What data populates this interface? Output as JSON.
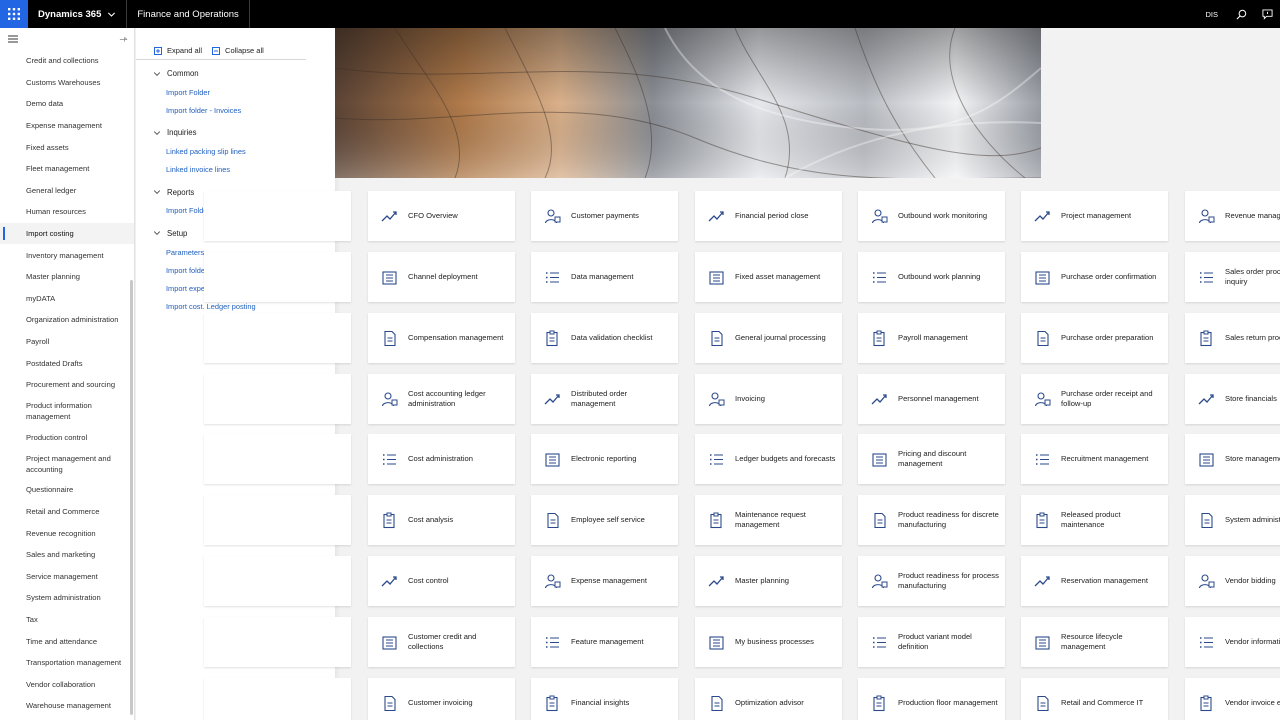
{
  "topbar": {
    "brand": "Dynamics 365",
    "product": "Finance and Operations",
    "company": "DIS",
    "icons": [
      "waffle-icon",
      "chevron-down-icon",
      "search-icon",
      "message-icon"
    ]
  },
  "accent": "#2266e3",
  "leftnav": {
    "items": [
      {
        "label": "Credit and collections"
      },
      {
        "label": "Customs Warehouses"
      },
      {
        "label": "Demo data"
      },
      {
        "label": "Expense management"
      },
      {
        "label": "Fixed assets"
      },
      {
        "label": "Fleet management"
      },
      {
        "label": "General ledger"
      },
      {
        "label": "Human resources"
      },
      {
        "label": "Import costing",
        "active": true
      },
      {
        "label": "Inventory management"
      },
      {
        "label": "Master planning"
      },
      {
        "label": "myDATA"
      },
      {
        "label": "Organization administration"
      },
      {
        "label": "Payroll"
      },
      {
        "label": "Postdated Drafts"
      },
      {
        "label": "Procurement and sourcing"
      },
      {
        "label": "Product information management"
      },
      {
        "label": "Production control"
      },
      {
        "label": "Project management and accounting"
      },
      {
        "label": "Questionnaire"
      },
      {
        "label": "Retail and Commerce"
      },
      {
        "label": "Revenue recognition"
      },
      {
        "label": "Sales and marketing"
      },
      {
        "label": "Service management"
      },
      {
        "label": "System administration"
      },
      {
        "label": "Tax"
      },
      {
        "label": "Time and attendance"
      },
      {
        "label": "Transportation management"
      },
      {
        "label": "Vendor collaboration"
      },
      {
        "label": "Warehouse management"
      }
    ]
  },
  "flyout": {
    "expand_all": "Expand all",
    "collapse_all": "Collapse all",
    "groups": [
      {
        "title": "Common",
        "links": [
          "Import Folder",
          "Import folder - Invoices"
        ]
      },
      {
        "title": "Inquiries",
        "links": [
          "Linked packing slip lines",
          "Linked invoice lines"
        ]
      },
      {
        "title": "Reports",
        "links": [
          "Import Folder"
        ]
      },
      {
        "title": "Setup",
        "links": [
          "Parameters",
          "Import folder type",
          "Import expense types",
          "Import cost. Ledger posting"
        ]
      }
    ]
  },
  "workspaces": {
    "columns": [
      [
        "CFO Overview",
        "Channel deployment",
        "Compensation management",
        "Cost accounting ledger administration",
        "Cost administration",
        "Cost analysis",
        "Cost control",
        "Customer credit and collections",
        "Customer invoicing"
      ],
      [
        "Customer payments",
        "Data management",
        "Data validation checklist",
        "Distributed order management",
        "Electronic reporting",
        "Employee self service",
        "Expense management",
        "Feature management",
        "Financial insights"
      ],
      [
        "Financial period close",
        "Fixed asset management",
        "General journal processing",
        "Invoicing",
        "Ledger budgets and forecasts",
        "Maintenance request management",
        "Master planning",
        "My business processes",
        "Optimization advisor"
      ],
      [
        "Outbound work monitoring",
        "Outbound work planning",
        "Payroll management",
        "Personnel management",
        "Pricing and discount management",
        "Product readiness for discrete manufacturing",
        "Product readiness for process manufacturing",
        "Product variant model definition",
        "Production floor management"
      ],
      [
        "Project management",
        "Purchase order confirmation",
        "Purchase order preparation",
        "Purchase order receipt and follow-up",
        "Recruitment management",
        "Released product maintenance",
        "Reservation management",
        "Resource lifecycle management",
        "Retail and Commerce IT"
      ],
      [
        "Revenue management",
        "Sales order processing and inquiry",
        "Sales return processing",
        "Store financials",
        "Store management",
        "System administration",
        "Vendor bidding",
        "Vendor information",
        "Vendor invoice entry"
      ]
    ],
    "icons": [
      "chart-line-icon",
      "building-icon",
      "document-icon",
      "person-icon",
      "list-icon",
      "clipboard-icon"
    ]
  }
}
